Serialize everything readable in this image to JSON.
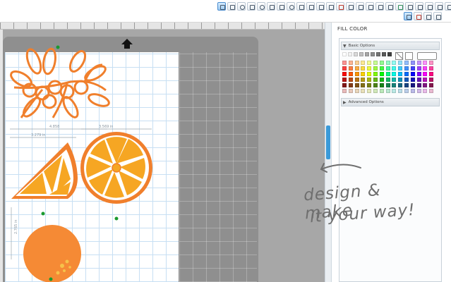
{
  "toolbar": {
    "row1_buttons": [
      "select",
      "rect",
      "ellipse",
      "polygon",
      "star",
      "knife",
      "text",
      "draw",
      "sketch",
      "curve",
      "lines",
      "freehand",
      "eraser",
      "weld",
      "subtract",
      "intersect",
      "group",
      "ungroup",
      "align",
      "replicate",
      "duplicate",
      "mirror",
      "zoom",
      "pan",
      "settings",
      "help"
    ],
    "row2_buttons": [
      "page-setup",
      "design",
      "send",
      "store"
    ]
  },
  "panel": {
    "title": "FILL COLOR",
    "basic_options": "Basic Options",
    "advanced_options": "Advanced Options",
    "picker_glyph": "⌀"
  },
  "artwork": {
    "dim_top": "4.858",
    "dim_slice": "3.279 in",
    "dim_orange": "3.569 in",
    "dim_side": "2.765 in",
    "colors": {
      "orange_dark": "#f07f2c",
      "orange_light": "#f6a623",
      "orange_fill": "#f58a35",
      "handle_green": "#1a9a2f"
    }
  },
  "note": {
    "line1": "design & make",
    "line2": "it your way!"
  },
  "colors": {
    "accent": "#3a9ad9",
    "mat": "#8f8f8f",
    "grid": "#c7dff3"
  }
}
